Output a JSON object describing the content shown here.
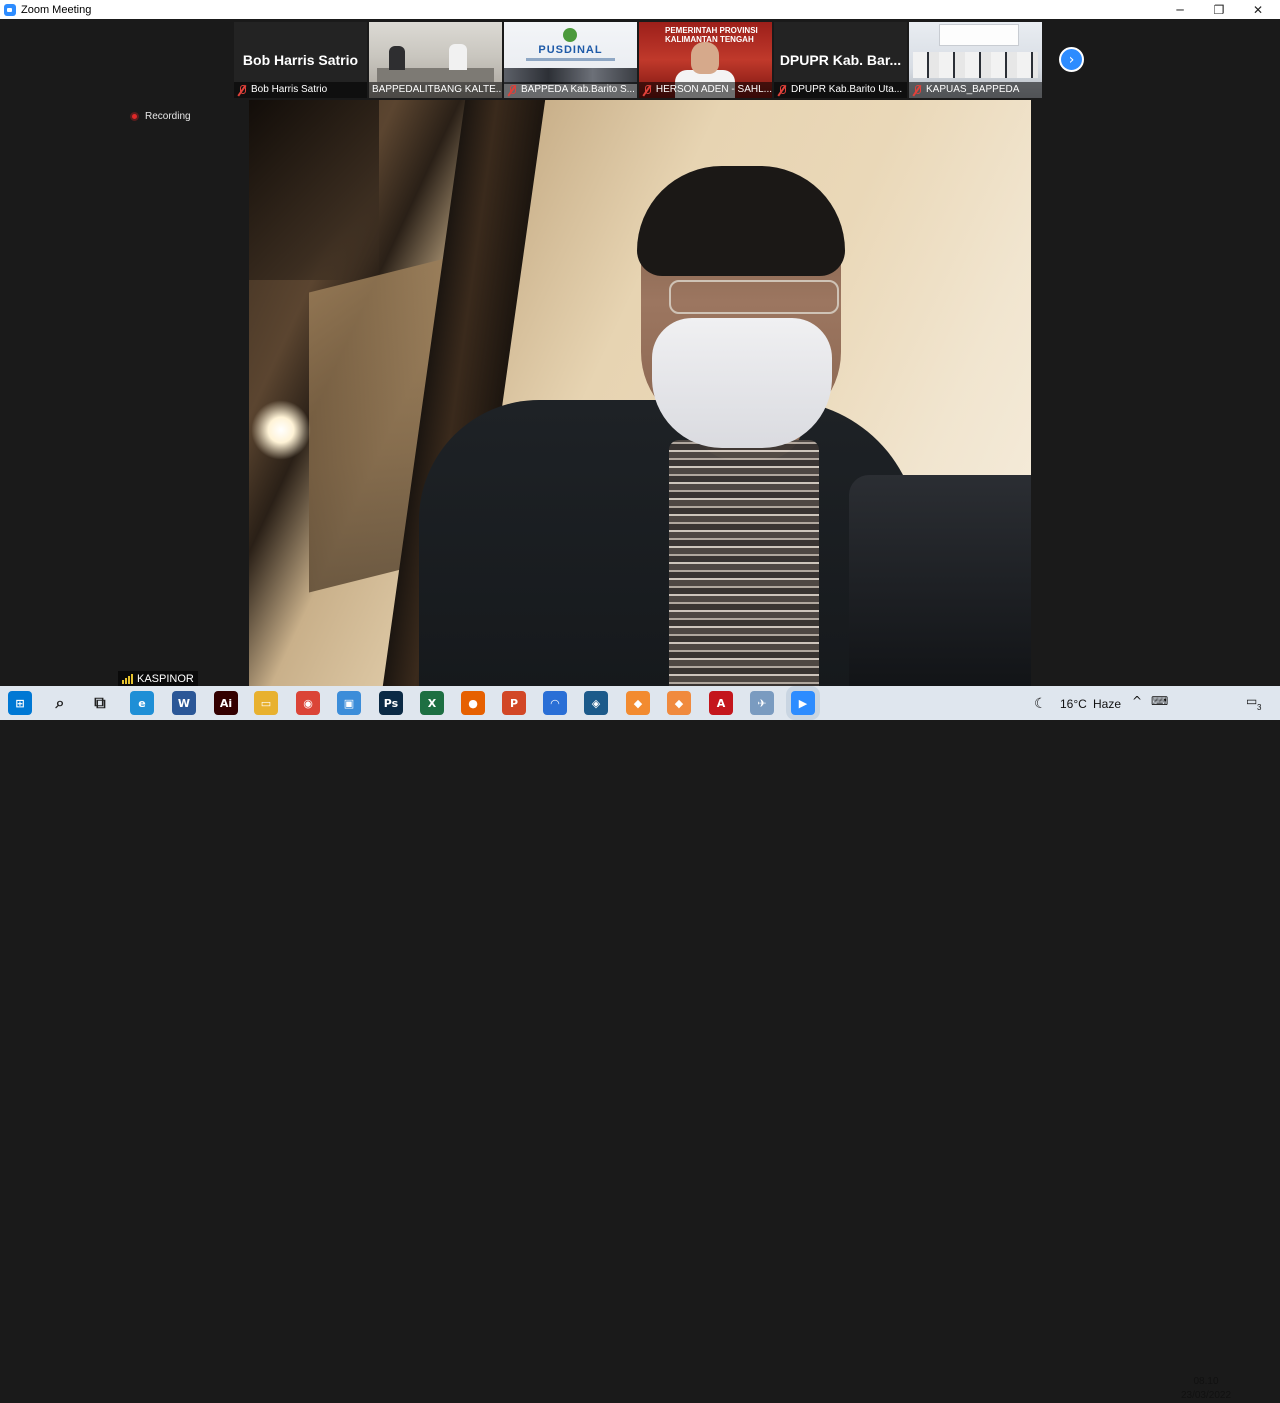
{
  "window": {
    "title": "Zoom Meeting",
    "minimize_glyph": "─",
    "restore_glyph": "❐",
    "close_glyph": "✕"
  },
  "thumbnails": [
    {
      "big_name": "Bob Harris Satrio",
      "label": "Bob Harris Satrio",
      "muted": true
    },
    {
      "big_name": "",
      "label": "BAPPEDALITBANG KALTE...",
      "muted": false
    },
    {
      "big_name": "",
      "label": "BAPPEDA Kab.Barito S...",
      "muted": true,
      "logo_text": "PUSDINAL"
    },
    {
      "big_name": "",
      "label": "HERSON ADEN - SAHL...",
      "muted": true,
      "banner": "PEMERINTAH PROVINSI KALIMANTAN TENGAH"
    },
    {
      "big_name": "DPUPR Kab. Bar...",
      "label": "DPUPR Kab.Barito Uta...",
      "muted": true
    },
    {
      "big_name": "",
      "label": "KAPUAS_BAPPEDA",
      "muted": true
    }
  ],
  "next_page_glyph": "›",
  "recording_label": "Recording",
  "active_speaker": {
    "name": "KASPINOR"
  },
  "taskbar": {
    "weather_temp": "16°C",
    "weather_desc": "Haze",
    "time": "08.10",
    "date": "23/03/2022",
    "notification_count": "3",
    "apps": [
      {
        "name": "windows-start-icon",
        "glyph": "⊞",
        "color": "#0078d4"
      },
      {
        "name": "search-icon",
        "glyph": "⌕",
        "color": "#222222"
      },
      {
        "name": "task-view-icon",
        "glyph": "⧉",
        "color": "#222222"
      },
      {
        "name": "edge-icon",
        "glyph": "e",
        "color": "#1f8fd6"
      },
      {
        "name": "word-icon",
        "glyph": "W",
        "color": "#2b5797"
      },
      {
        "name": "illustrator-icon",
        "glyph": "Ai",
        "color": "#330000"
      },
      {
        "name": "file-explorer-icon",
        "glyph": "▭",
        "color": "#e8b12f"
      },
      {
        "name": "chrome-icon",
        "glyph": "◉",
        "color": "#db4437"
      },
      {
        "name": "photos-icon",
        "glyph": "▣",
        "color": "#3c8dd9"
      },
      {
        "name": "photoshop-icon",
        "glyph": "Ps",
        "color": "#0b2a45"
      },
      {
        "name": "excel-icon",
        "glyph": "X",
        "color": "#1d6f42"
      },
      {
        "name": "firefox-icon",
        "glyph": "●",
        "color": "#e66000"
      },
      {
        "name": "powerpoint-icon",
        "glyph": "P",
        "color": "#d24726"
      },
      {
        "name": "arc-icon",
        "glyph": "◠",
        "color": "#2a6fd6"
      },
      {
        "name": "sketchup-icon",
        "glyph": "◈",
        "color": "#1c5a8a"
      },
      {
        "name": "bookmark-app-icon",
        "glyph": "◆",
        "color": "#f28b30"
      },
      {
        "name": "blender-icon",
        "glyph": "◆",
        "color": "#f08a3e"
      },
      {
        "name": "acrobat-icon",
        "glyph": "A",
        "color": "#c4161c"
      },
      {
        "name": "satellite-app-icon",
        "glyph": "✈",
        "color": "#7a9bc0"
      },
      {
        "name": "zoom-icon",
        "glyph": "▶",
        "color": "#2d8cff"
      }
    ]
  }
}
